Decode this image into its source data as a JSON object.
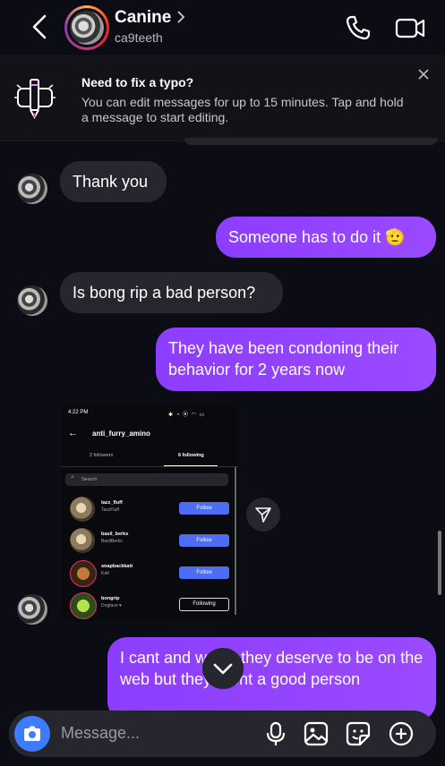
{
  "header": {
    "name": "Canine",
    "username": "ca9teeth"
  },
  "tip": {
    "title": "Need to fix a typo?",
    "body": "You can edit messages for up to 15 minutes. Tap and hold a message to start editing."
  },
  "messages": [
    {
      "side": "in",
      "text": "Thank you"
    },
    {
      "side": "out",
      "text": "Someone has to do it 🫡"
    },
    {
      "side": "in",
      "text": "Is bong rip a bad person?"
    },
    {
      "side": "out",
      "text": "They have been condoning their behavior for 2 years now"
    },
    {
      "side": "out",
      "text": "I cant and w      say they deserve to be on the web      but they arent a good person"
    }
  ],
  "shared_screenshot": {
    "status_time": "4:22 PM",
    "title": "anti_furry_amino",
    "tabs": [
      "2 followers",
      "6 following"
    ],
    "search_placeholder": "Search",
    "rows": [
      {
        "name": "tazz_fluff",
        "sub": "TazzFluff",
        "button": "Follow"
      },
      {
        "name": "basil_berks",
        "sub": "BasilBerks",
        "button": "Follow"
      },
      {
        "name": "snapbackkatt",
        "sub": "Katt",
        "button": "Follow"
      },
      {
        "name": "bongrip",
        "sub": "Dogface ♥",
        "button": "Following"
      }
    ]
  },
  "composer": {
    "placeholder": "Message..."
  },
  "colors": {
    "accent": "#9a4aff",
    "camera": "#3d7cff",
    "background": "#0c0c14",
    "incoming": "#26262e"
  }
}
